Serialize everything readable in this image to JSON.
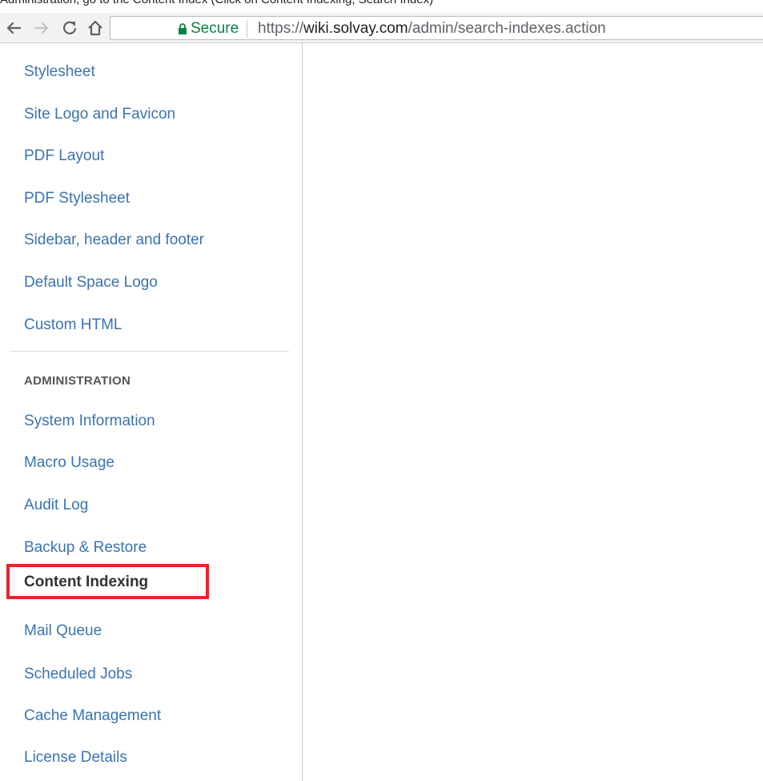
{
  "caption": "Administration, go to the Content Index (Click on Content Indexing, Search Index)",
  "browser": {
    "secure_label": "Secure",
    "url_scheme": "https://",
    "url_host": "wiki.solvay.com",
    "url_path": "/admin/search-indexes.action"
  },
  "sidebar": {
    "items_top": [
      {
        "label": "Stylesheet"
      },
      {
        "label": "Site Logo and Favicon"
      },
      {
        "label": "PDF Layout"
      },
      {
        "label": "PDF Stylesheet"
      },
      {
        "label": "Sidebar, header and footer"
      },
      {
        "label": "Default Space Logo"
      },
      {
        "label": "Custom HTML"
      }
    ],
    "section_heading": "ADMINISTRATION",
    "items_admin": [
      {
        "label": "System Information"
      },
      {
        "label": "Macro Usage"
      },
      {
        "label": "Audit Log"
      },
      {
        "label": "Backup & Restore"
      },
      {
        "label": "Content Indexing"
      },
      {
        "label": "Mail Queue"
      },
      {
        "label": "Scheduled Jobs"
      },
      {
        "label": "Cache Management"
      },
      {
        "label": "License Details"
      }
    ]
  },
  "colors": {
    "link": "#3b73af",
    "highlight_border": "#e8232c",
    "secure_green": "#0b8043"
  }
}
